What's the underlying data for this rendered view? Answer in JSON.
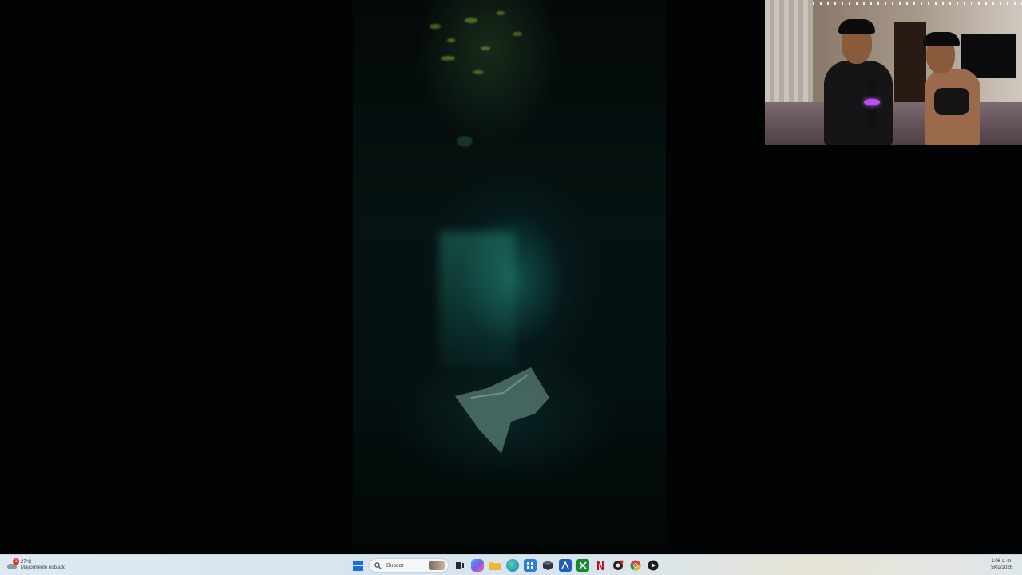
{
  "window": {
    "game_view": {
      "icon": "underwater-scene"
    },
    "webcam": {
      "icon": "webcam-feed"
    }
  },
  "taskbar": {
    "weather": {
      "temp": "27°C",
      "condition": "Mayormente nublado",
      "badge": "1",
      "icon": "cloud-icon"
    },
    "search": {
      "placeholder": "Buscar",
      "icon": "search-icon"
    },
    "apps": [
      {
        "name": "start",
        "icon": "windows-icon",
        "color": "#1a6fd6"
      },
      {
        "name": "task-view",
        "icon": "task-view-icon",
        "color": "#2a2a2a"
      },
      {
        "name": "copilot",
        "icon": "copilot-icon",
        "color": "#5b7cf0"
      },
      {
        "name": "file-explorer",
        "icon": "folder-icon",
        "color": "#e8b83a"
      },
      {
        "name": "edge",
        "icon": "edge-icon",
        "color": "#1e9a8e"
      },
      {
        "name": "store",
        "icon": "store-icon",
        "color": "#2f7fd4"
      },
      {
        "name": "app-dark",
        "icon": "cube-icon",
        "color": "#2d3440"
      },
      {
        "name": "app-blue",
        "icon": "app-icon",
        "color": "#1f5fb8"
      },
      {
        "name": "xbox",
        "icon": "xbox-icon",
        "color": "#178a2f"
      },
      {
        "name": "netflix",
        "icon": "netflix-icon",
        "color": "#c01616"
      },
      {
        "name": "app-red-dot",
        "icon": "record-icon",
        "color": "#3a2a2a"
      },
      {
        "name": "chrome",
        "icon": "chrome-icon",
        "color": "#e2a020"
      },
      {
        "name": "media-player",
        "icon": "play-icon",
        "color": "#202020"
      }
    ],
    "clock": {
      "time": "1:06 a. m.",
      "date": "5/02/2026"
    }
  }
}
